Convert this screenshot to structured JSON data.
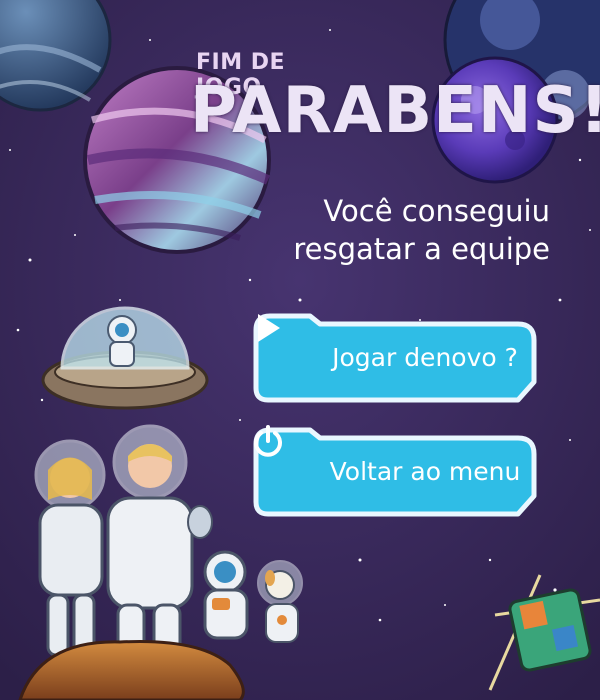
{
  "screen": {
    "title_small": "FIM DE JOGO",
    "title_big": "PARABENS!",
    "subtitle_line1": "Você conseguiu",
    "subtitle_line2": "resgatar a equipe"
  },
  "buttons": {
    "play_again": {
      "label": "Jogar denovo ?",
      "icon": "play-icon"
    },
    "back_to_menu": {
      "label": "Voltar ao menu",
      "icon": "power-icon"
    }
  },
  "colors": {
    "background": "#3a2a5c",
    "button_fill": "#2fbde6",
    "button_border": "#e9f7ff",
    "title": "#ece4f6"
  }
}
